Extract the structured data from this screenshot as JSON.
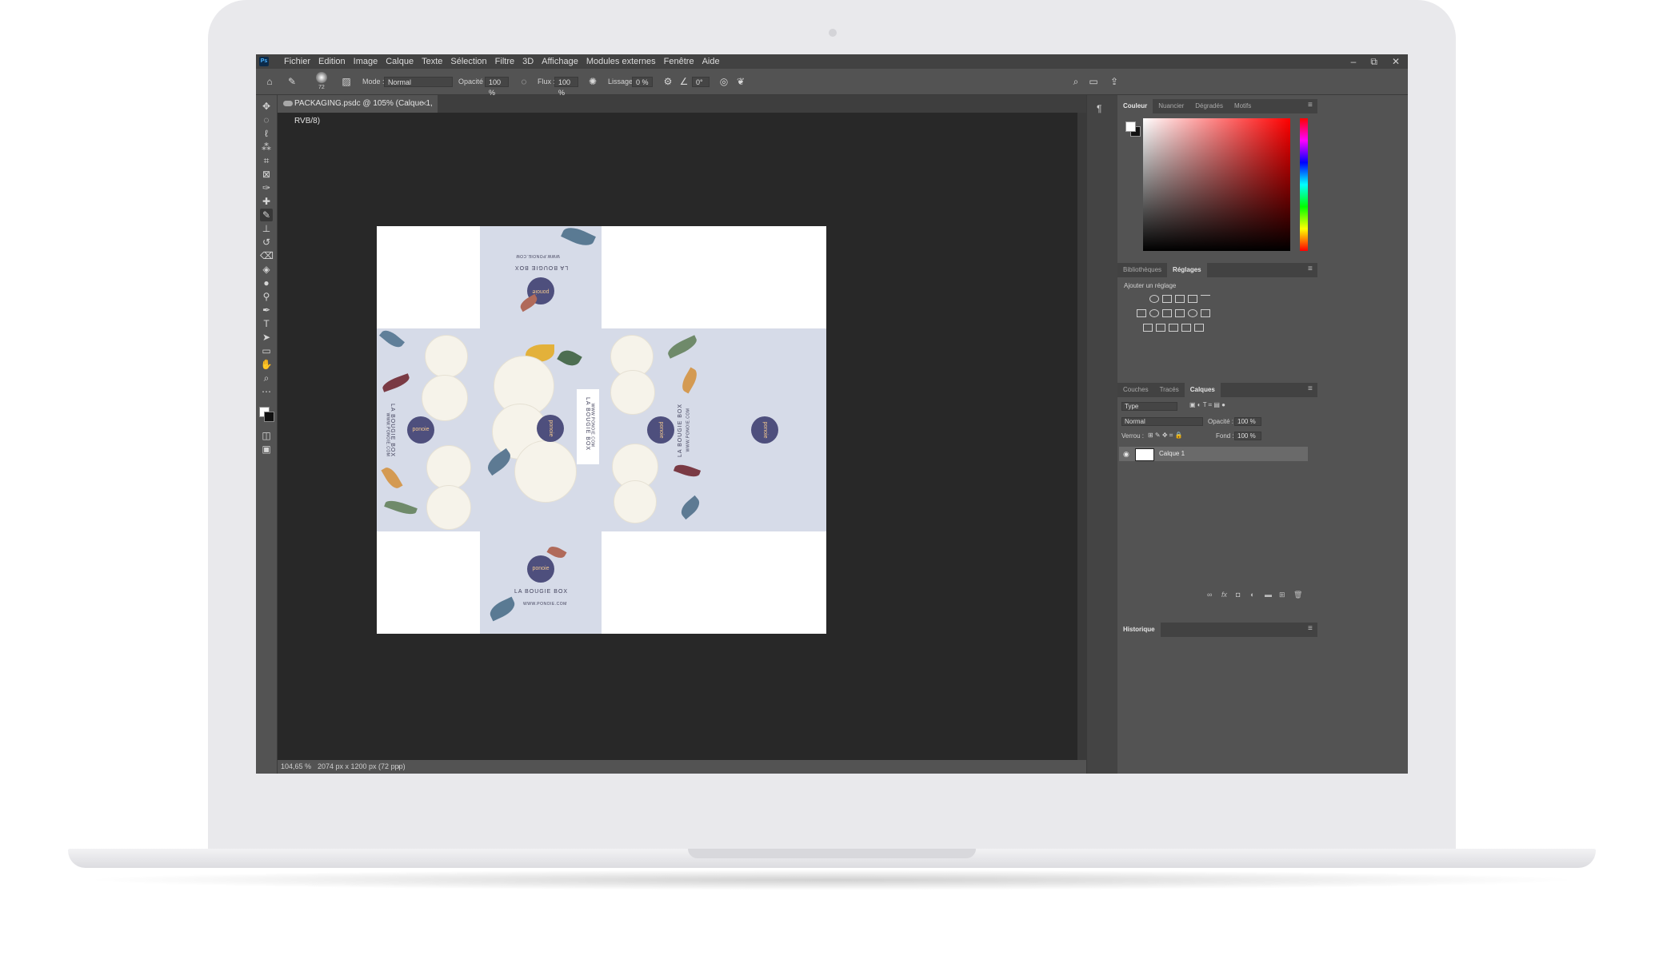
{
  "menubar": {
    "app_badge": "Ps",
    "menus": [
      "Fichier",
      "Edition",
      "Image",
      "Calque",
      "Texte",
      "Sélection",
      "Filtre",
      "3D",
      "Affichage",
      "Modules externes",
      "Fenêtre",
      "Aide"
    ],
    "window_controls": [
      "–",
      "⧉",
      "✕"
    ]
  },
  "options": {
    "brush_size": "72",
    "mode_label": "Mode :",
    "mode_value": "Normal",
    "opacity_label": "Opacité :",
    "opacity_value": "100 %",
    "flow_label": "Flux :",
    "flow_value": "100 %",
    "smoothing_label": "Lissage :",
    "smoothing_value": "0 %",
    "angle_value": "0°"
  },
  "document": {
    "tab_title": "PACKAGING.psdc @ 105% (Calque 1, RVB/8)",
    "close": "×",
    "zoom": "104,65 %",
    "dimensions": "2074 px x 1200 px (72 ppp)",
    "status_arrow": "›"
  },
  "artwork": {
    "brand": "ponoie",
    "title": "LA BOUGIE BOX",
    "url": "WWW.PONOIE.COM",
    "colors": {
      "panel": "#d6dbe8",
      "logo": "#4e4f7d"
    }
  },
  "panels": {
    "color_tabs": [
      "Couleur",
      "Nuancier",
      "Dégradés",
      "Motifs"
    ],
    "adjust_tabs": [
      "Bibliothèques",
      "Réglages"
    ],
    "adjust_hint": "Ajouter un réglage",
    "layer_tabs": [
      "Couches",
      "Tracés",
      "Calques"
    ],
    "filter_kind": "Type",
    "blend_mode": "Normal",
    "layer_opacity_label": "Opacité :",
    "layer_opacity": "100 %",
    "lock_label": "Verrou :",
    "fill_label": "Fond :",
    "fill_value": "100 %",
    "layer_name": "Calque 1",
    "history_tab": "Historique"
  }
}
